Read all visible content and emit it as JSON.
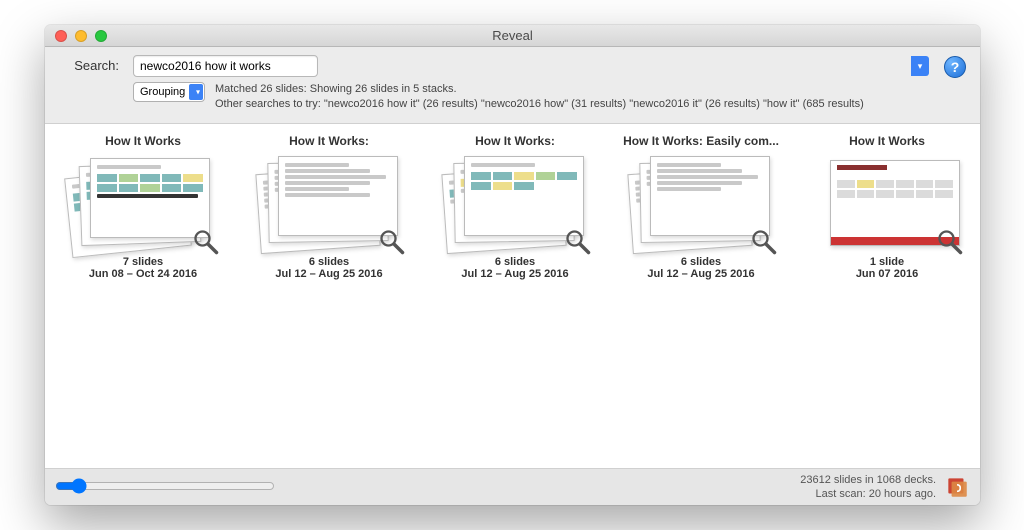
{
  "window": {
    "title": "Reveal"
  },
  "search": {
    "label": "Search:",
    "value": "newco2016 how it works",
    "grouping_label": "Grouping",
    "status": "Matched 26 slides: Showing 26 slides in 5 stacks.",
    "suggestions": "Other searches to try: \"newco2016 how it\" (26 results) \"newco2016 how\" (31 results) \"newco2016 it\" (26 results) \"how it\" (685 results)"
  },
  "stacks": [
    {
      "title": "How It Works",
      "count": "7 slides",
      "dates": "Jun 08 – Oct 24 2016"
    },
    {
      "title": "How It Works:",
      "count": "6 slides",
      "dates": "Jul 12 – Aug 25 2016"
    },
    {
      "title": "How It Works:",
      "count": "6 slides",
      "dates": "Jul 12 – Aug 25 2016"
    },
    {
      "title": "How It Works: Easily com...",
      "count": "6 slides",
      "dates": "Jul 12 – Aug 25 2016"
    },
    {
      "title": "How It Works",
      "count": "1 slide",
      "dates": "Jun 07 2016"
    }
  ],
  "footer": {
    "library": "23612 slides in 1068 decks.",
    "scan": "Last scan: 20 hours ago."
  },
  "icons": {
    "help": "?",
    "combo_arrow": "▾"
  }
}
